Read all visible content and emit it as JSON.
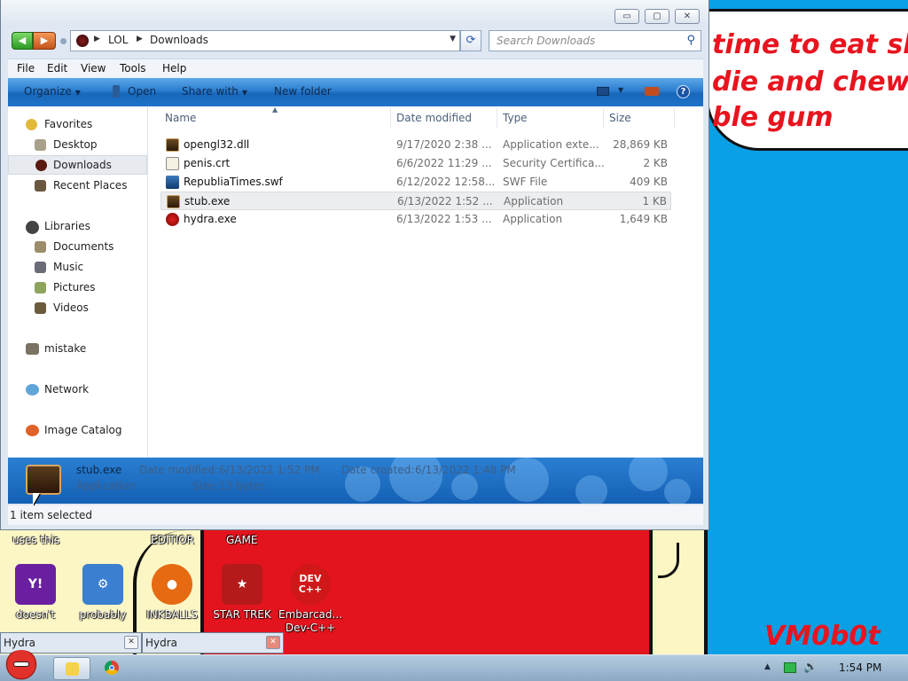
{
  "window": {
    "controls": {
      "minimize": "▭",
      "maximize": "▢",
      "close": "✕"
    }
  },
  "address": {
    "crumbs": [
      "LOL",
      "Downloads"
    ],
    "search_placeholder": "Search Downloads"
  },
  "menu": [
    "File",
    "Edit",
    "View",
    "Tools",
    "Help"
  ],
  "toolbar": {
    "organize": "Organize",
    "open": "Open",
    "share_with": "Share with",
    "new_folder": "New folder",
    "help": "?"
  },
  "nav": {
    "favorites": "Favorites",
    "desktop": "Desktop",
    "downloads": "Downloads",
    "recent_places": "Recent Places",
    "libraries": "Libraries",
    "documents": "Documents",
    "music": "Music",
    "pictures": "Pictures",
    "videos": "Videos",
    "mistake": "mistake",
    "network": "Network",
    "image_catalog": "Image Catalog"
  },
  "columns": {
    "name": "Name",
    "date": "Date modified",
    "type": "Type",
    "size": "Size"
  },
  "files": [
    {
      "name": "opengl32.dll",
      "date": "9/17/2020 2:38 ...",
      "type": "Application exte...",
      "size": "28,869 KB",
      "icon": "dll-icon"
    },
    {
      "name": "penis.crt",
      "date": "6/6/2022 11:29 ...",
      "type": "Security Certifica...",
      "size": "2 KB",
      "icon": "certificate-icon"
    },
    {
      "name": "RepubliaTimes.swf",
      "date": "6/12/2022 12:58...",
      "type": "SWF File",
      "size": "409 KB",
      "icon": "swf-icon"
    },
    {
      "name": "stub.exe",
      "date": "6/13/2022 1:52 ...",
      "type": "Application",
      "size": "1 KB",
      "icon": "application-icon"
    },
    {
      "name": "hydra.exe",
      "date": "6/13/2022 1:53 ...",
      "type": "Application",
      "size": "1,649 KB",
      "icon": "hydra-icon"
    }
  ],
  "details": {
    "name": "stub.exe",
    "type": "Application",
    "modified_label": "Date modified:",
    "modified_value": "6/13/2022 1:52 PM",
    "created_label": "Date created:",
    "created_value": "6/13/2022 1:48 PM",
    "size_label": "Size:",
    "size_value": "13 bytes"
  },
  "status": "1 item selected",
  "wallpaper": {
    "bubble_lines": [
      "time to eat shit",
      "die and chew",
      "ble gum"
    ],
    "watermark": "VM0b0t",
    "labels": [
      "uses this",
      "EDITIOR",
      "GAME"
    ]
  },
  "desktop_icons": [
    {
      "label": "doesn't",
      "icon": "yahoo-messenger-icon",
      "color": "#6a1fa0",
      "glyph": "Y!"
    },
    {
      "label": "probably",
      "icon": "system-gears-icon",
      "color": "#3a7fd0",
      "glyph": "⚙"
    },
    {
      "label": "INKBALLS",
      "icon": "inkball-icon",
      "color": "#e56a12",
      "glyph": "●"
    },
    {
      "label": "STAR TREK",
      "icon": "star-trek-icon",
      "color": "#b51a1a",
      "glyph": "★"
    },
    {
      "label": "Embarcad... Dev-C++",
      "icon": "dev-cpp-icon",
      "color": "#d01818",
      "glyph": "DEV C++"
    }
  ],
  "hydra_windows": [
    {
      "title": "Hydra",
      "close": "✕"
    },
    {
      "title": "Hydra",
      "close": "✕"
    }
  ],
  "tray": {
    "clock": "1:54 PM",
    "arrow": "▲",
    "volume": "🔊"
  }
}
